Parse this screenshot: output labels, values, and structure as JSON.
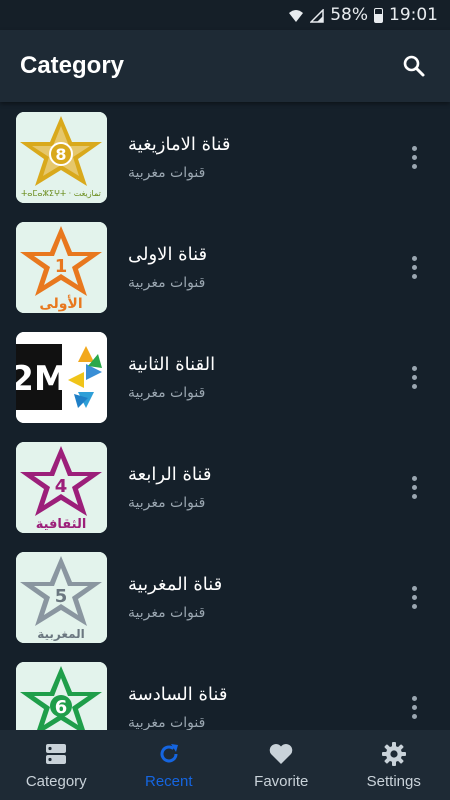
{
  "status_bar": {
    "battery_percent": "58%",
    "time": "19:01",
    "icons": [
      "wifi-icon",
      "signal-icon",
      "battery-icon"
    ]
  },
  "app_bar": {
    "title": "Category",
    "search_icon": "search-icon"
  },
  "channels": [
    {
      "name": "قناة الامازيغية",
      "subtitle": "قنوات مغربية",
      "logo_number": "8",
      "logo_caption": "ⵜⴰⵎⴰⵣⵉⵖⵜ · تمازيغت",
      "logo_color": "#d4a017"
    },
    {
      "name": "قناة الاولى",
      "subtitle": "قنوات مغربية",
      "logo_number": "1",
      "logo_caption": "الأولى",
      "logo_color": "#e8781e"
    },
    {
      "name": "القناة الثانية",
      "subtitle": "قنوات مغربية",
      "logo_number": "2M",
      "logo_caption": "",
      "logo_color": "#222222"
    },
    {
      "name": "قناة الرابعة",
      "subtitle": "قنوات مغربية",
      "logo_number": "4",
      "logo_caption": "الثقافية",
      "logo_color": "#9c1f7a"
    },
    {
      "name": "قناة المغربية",
      "subtitle": "قنوات مغربية",
      "logo_number": "5",
      "logo_caption": "المغربية",
      "logo_color": "#8a96a0"
    },
    {
      "name": "قناة السادسة",
      "subtitle": "قنوات مغربية",
      "logo_number": "6",
      "logo_caption": "",
      "logo_color": "#1f9e4a"
    }
  ],
  "bottom_nav": {
    "items": [
      {
        "label": "Category",
        "icon": "category-icon"
      },
      {
        "label": "Recent",
        "icon": "refresh-icon"
      },
      {
        "label": "Favorite",
        "icon": "heart-icon"
      },
      {
        "label": "Settings",
        "icon": "gear-icon"
      }
    ],
    "active": "Recent"
  },
  "colors": {
    "background": "#15202a",
    "bar": "#1e2a35",
    "accent": "#1565e0",
    "secondary_text": "#9aa6b0"
  }
}
